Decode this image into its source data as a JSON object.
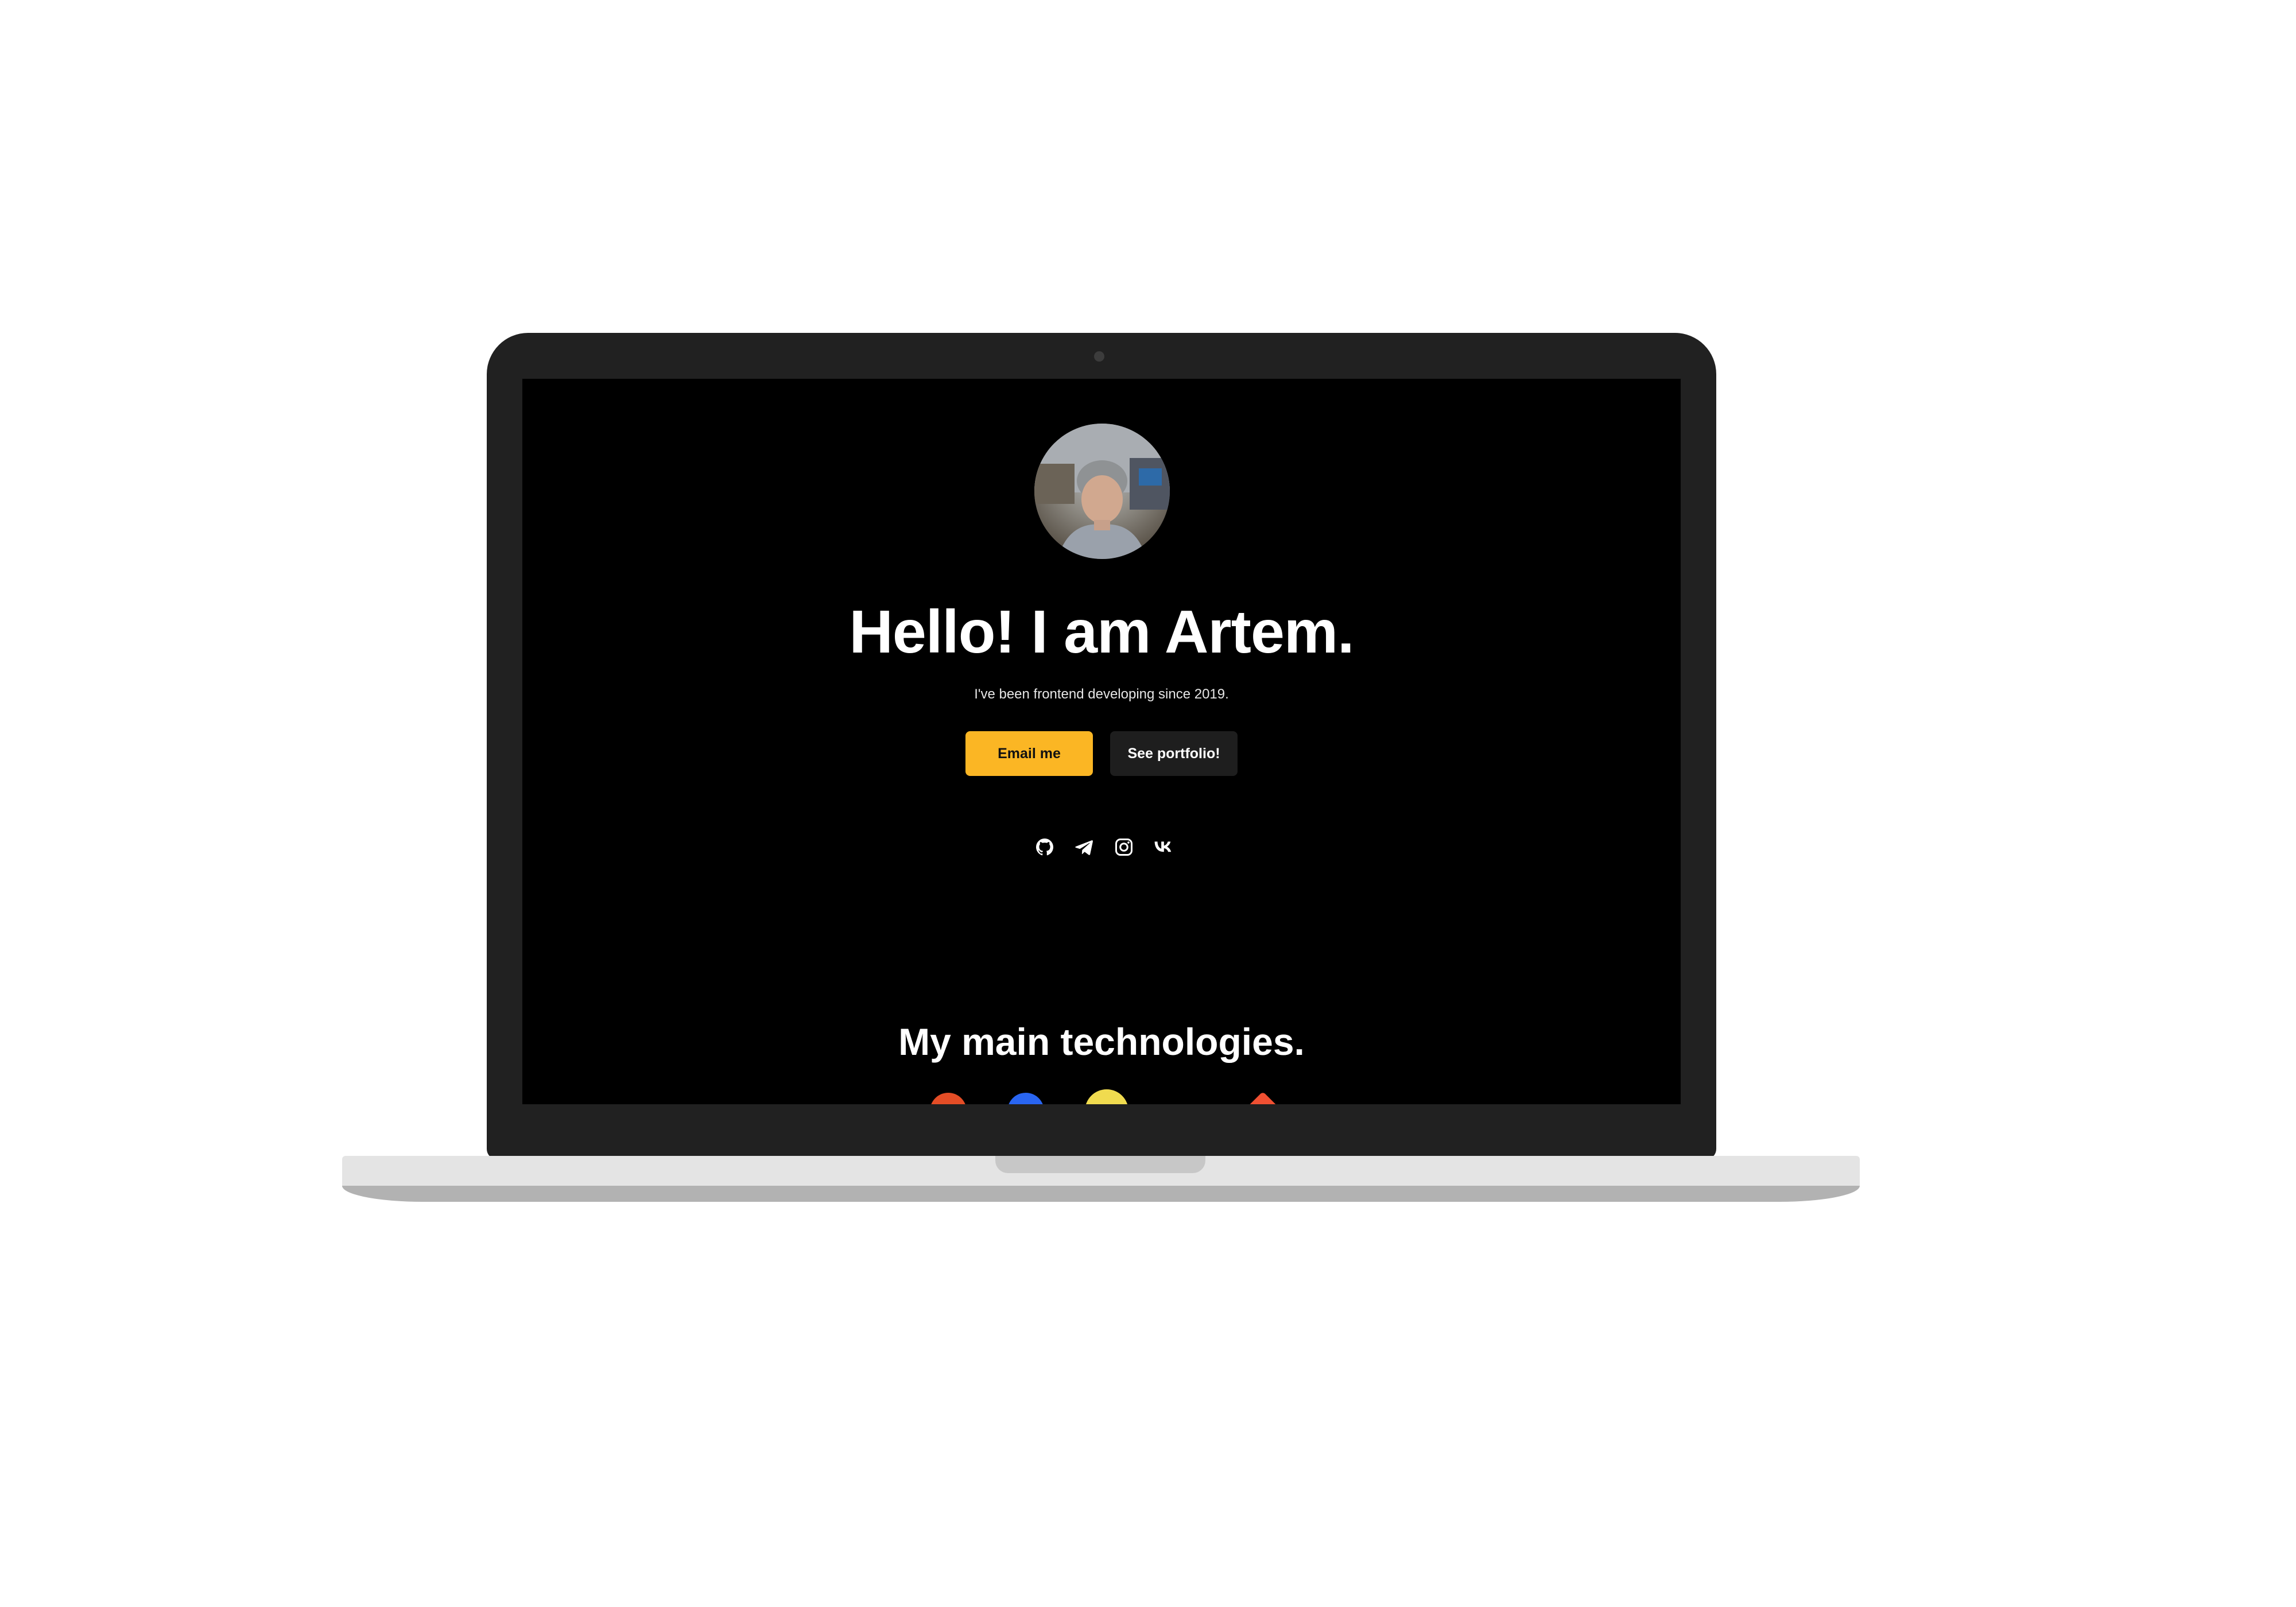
{
  "hero": {
    "title": "Hello! I am Artem.",
    "subtitle": "I've been frontend developing since 2019.",
    "email_button": "Email me",
    "portfolio_button": "See portfolio!"
  },
  "socials": [
    {
      "icon": "github-icon"
    },
    {
      "icon": "telegram-icon"
    },
    {
      "icon": "instagram-icon"
    },
    {
      "icon": "vk-icon"
    }
  ],
  "technologies": {
    "title": "My main technologies."
  },
  "colors": {
    "accent": "#fbb624",
    "page_background": "#000000",
    "secondary_button": "#1e1e1e",
    "laptop_frame": "#212121"
  }
}
